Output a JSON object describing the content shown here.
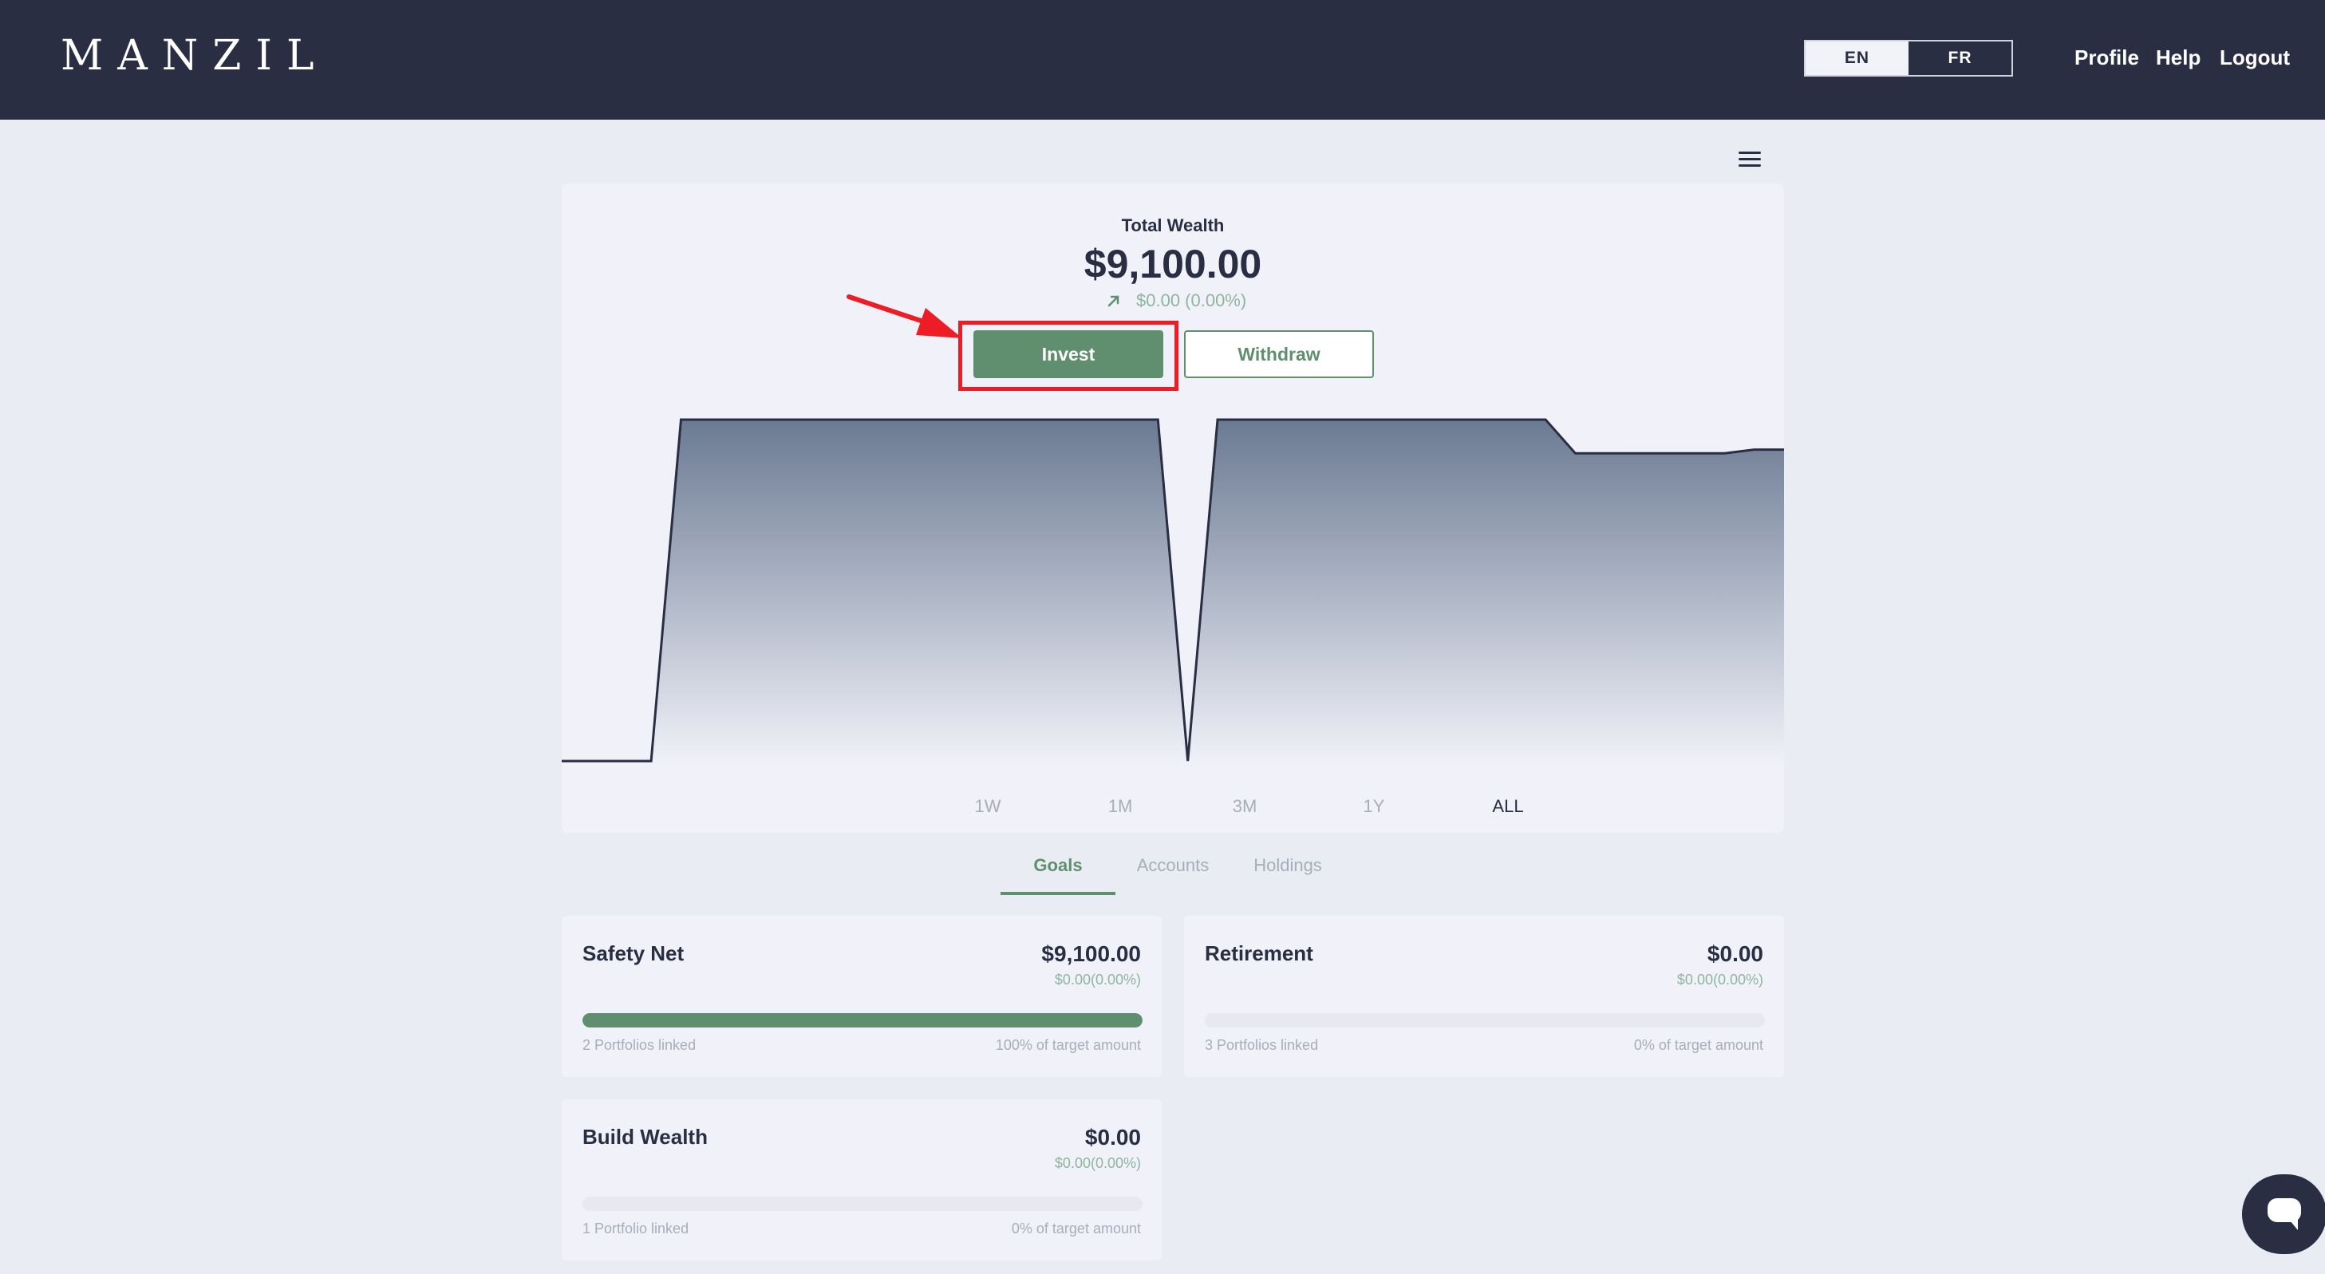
{
  "header": {
    "logo": "MANZIL",
    "languages": [
      {
        "label": "EN",
        "active": true
      },
      {
        "label": "FR",
        "active": false
      }
    ],
    "nav": {
      "profile": "Profile",
      "help": "Help",
      "logout": "Logout"
    }
  },
  "wealth": {
    "label": "Total Wealth",
    "amount": "$9,100.00",
    "change": "$0.00 (0.00%)",
    "invest_label": "Invest",
    "withdraw_label": "Withdraw"
  },
  "chart_data": {
    "type": "area",
    "title": "",
    "xlabel": "",
    "ylabel": "",
    "grid": false,
    "series": [
      {
        "values": [
          0,
          0,
          0,
          0,
          9100,
          9100,
          9100,
          9100,
          9100,
          9100,
          9100,
          9100,
          9100,
          9100,
          9100,
          9100,
          9100,
          9100,
          9100,
          9100,
          9100,
          0,
          9100,
          9100,
          9100,
          9100,
          9100,
          9100,
          9100,
          9100,
          9100,
          9100,
          9100,
          9100,
          8200,
          8200,
          8200,
          8200,
          8200,
          8200,
          8300,
          8300
        ]
      }
    ],
    "color": "#292e43",
    "fill_top": "#6b7a93",
    "fill_bottom": "#f1f2f9"
  },
  "ranges": [
    {
      "label": "1W",
      "active": false
    },
    {
      "label": "1M",
      "active": false
    },
    {
      "label": "3M",
      "active": false
    },
    {
      "label": "1Y",
      "active": false
    },
    {
      "label": "ALL",
      "active": true
    }
  ],
  "tabs": [
    {
      "label": "Goals",
      "active": true
    },
    {
      "label": "Accounts",
      "active": false
    },
    {
      "label": "Holdings",
      "active": false
    }
  ],
  "goals": [
    {
      "name": "Safety Net",
      "amount": "$9,100.00",
      "change": "$0.00(0.00%)",
      "progress": 1.0,
      "linked": "2 Portfolios linked",
      "target": "100% of target amount"
    },
    {
      "name": "Retirement",
      "amount": "$0.00",
      "change": "$0.00(0.00%)",
      "progress": 0,
      "linked": "3 Portfolios linked",
      "target": "0% of target amount"
    },
    {
      "name": "Build Wealth",
      "amount": "$0.00",
      "change": "$0.00(0.00%)",
      "progress": 0,
      "linked": "1 Portfolio linked",
      "target": "0% of target amount"
    }
  ],
  "icons": {
    "menu": "hamburger-menu-icon",
    "trend": "arrow-up-right-icon",
    "chat": "chat-bubble-icon",
    "annotation": "red-arrow-pointer"
  },
  "colors": {
    "header_bg": "#292e43",
    "accent_green": "#5f8f6f",
    "change_green": "#8fb59d",
    "highlight_red": "#ee1c25"
  }
}
